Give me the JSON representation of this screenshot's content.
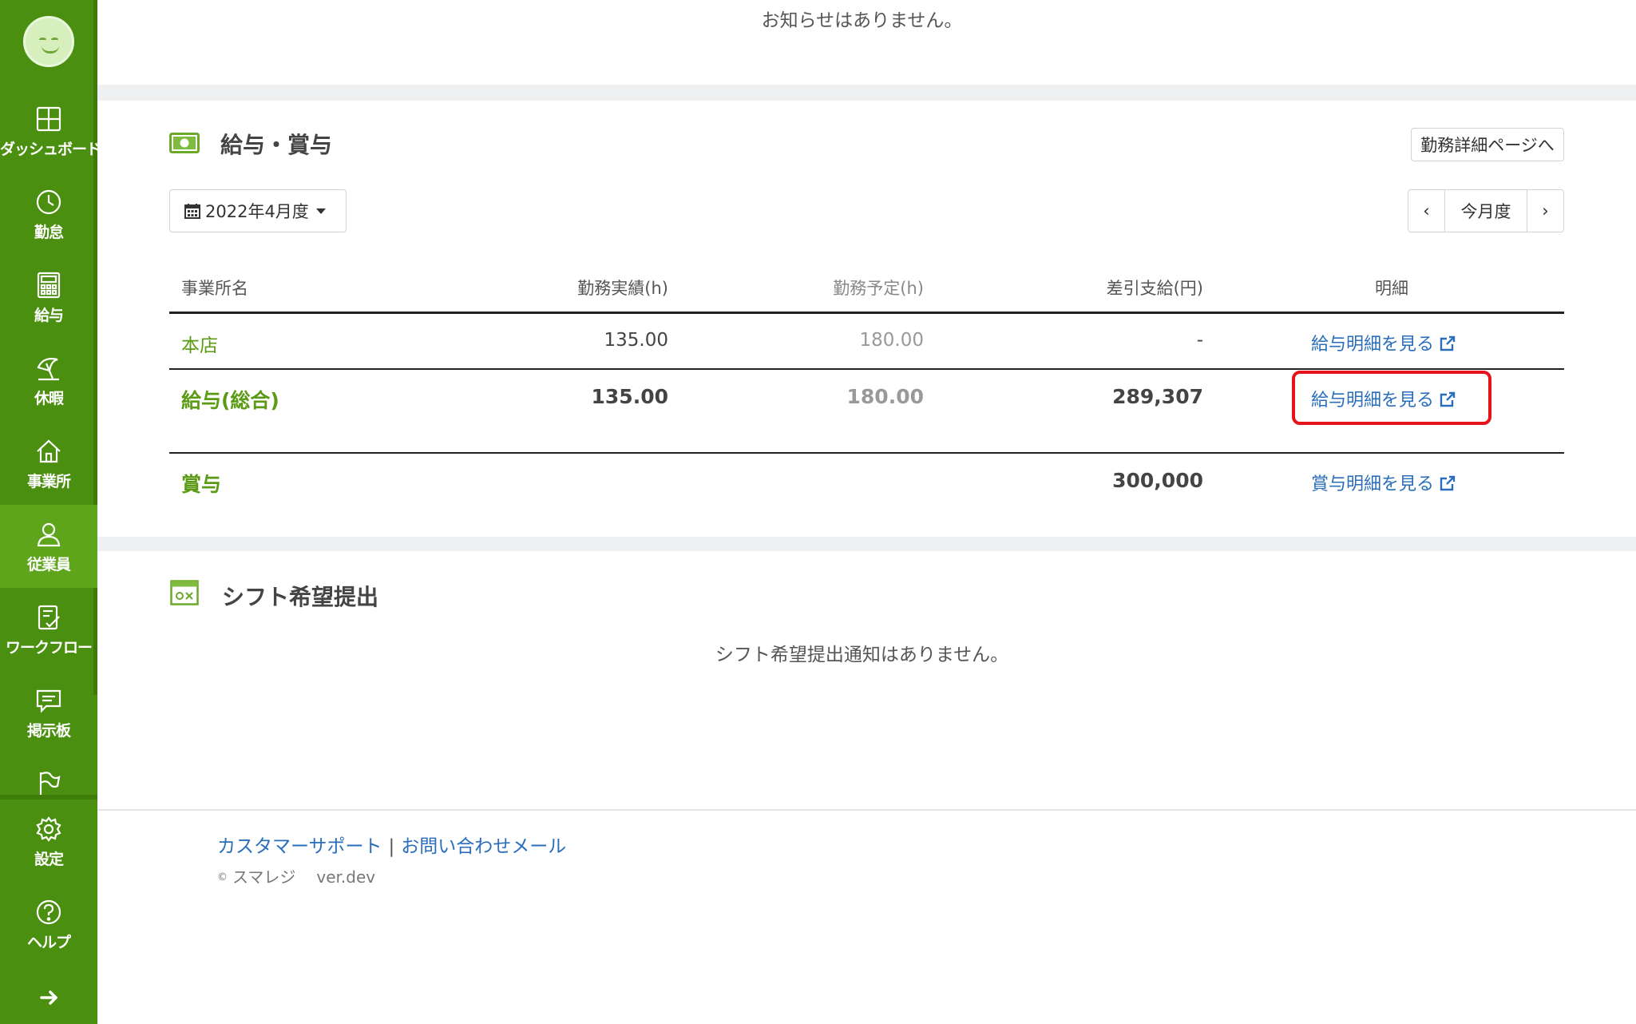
{
  "sidebar": {
    "items": [
      {
        "label": "ダッシュボード",
        "icon": "dashboard-icon"
      },
      {
        "label": "勤怠",
        "icon": "clock-icon"
      },
      {
        "label": "給与",
        "icon": "calculator-icon"
      },
      {
        "label": "休暇",
        "icon": "beach-umbrella-icon"
      },
      {
        "label": "事業所",
        "icon": "home-icon"
      },
      {
        "label": "従業員",
        "icon": "person-icon",
        "active": true
      },
      {
        "label": "ワークフロー",
        "icon": "checklist-icon"
      },
      {
        "label": "掲示板",
        "icon": "message-icon"
      },
      {
        "label": "",
        "icon": "flag-icon"
      }
    ],
    "bottom_items": [
      {
        "label": "設定",
        "icon": "gear-icon"
      },
      {
        "label": "ヘルプ",
        "icon": "help-icon"
      }
    ],
    "expand_icon": "arrow-right-icon"
  },
  "notices": {
    "empty_text": "お知らせはありません。"
  },
  "payroll": {
    "title": "給与・賞与",
    "title_icon": "money-icon",
    "detail_button": "勤務詳細ページへ",
    "month_select": "2022年4月度",
    "pager": {
      "prev": "‹",
      "current": "今月度",
      "next": "›"
    },
    "columns": [
      "事業所名",
      "勤務実績(h)",
      "勤務予定(h)",
      "差引支給(円)",
      "明細"
    ],
    "rows": [
      {
        "name": "本店",
        "actual": "135.00",
        "planned": "180.00",
        "net_pay": "-",
        "link": "給与明細を見る"
      },
      {
        "name": "給与(総合)",
        "actual": "135.00",
        "planned": "180.00",
        "net_pay": "289,307",
        "link": "給与明細を見る"
      },
      {
        "name": "賞与",
        "actual": "",
        "planned": "",
        "net_pay": "300,000",
        "link": "賞与明細を見る"
      }
    ]
  },
  "shift": {
    "title": "シフト希望提出",
    "title_icon": "calendar-ox-icon",
    "empty_text": "シフト希望提出通知はありません。"
  },
  "footer": {
    "support_link": "カスタマーサポート",
    "separator": "|",
    "contact_link": "お問い合わせメール",
    "copyright_mark": "©",
    "brand": "スマレジ",
    "version": "ver.dev"
  },
  "colors": {
    "sidebar": "#4a8f0f",
    "sidebar_active": "#5ea51c",
    "accent_green": "#5b9a14",
    "link_blue": "#2a6ebb",
    "highlight_red": "#e5141b"
  }
}
